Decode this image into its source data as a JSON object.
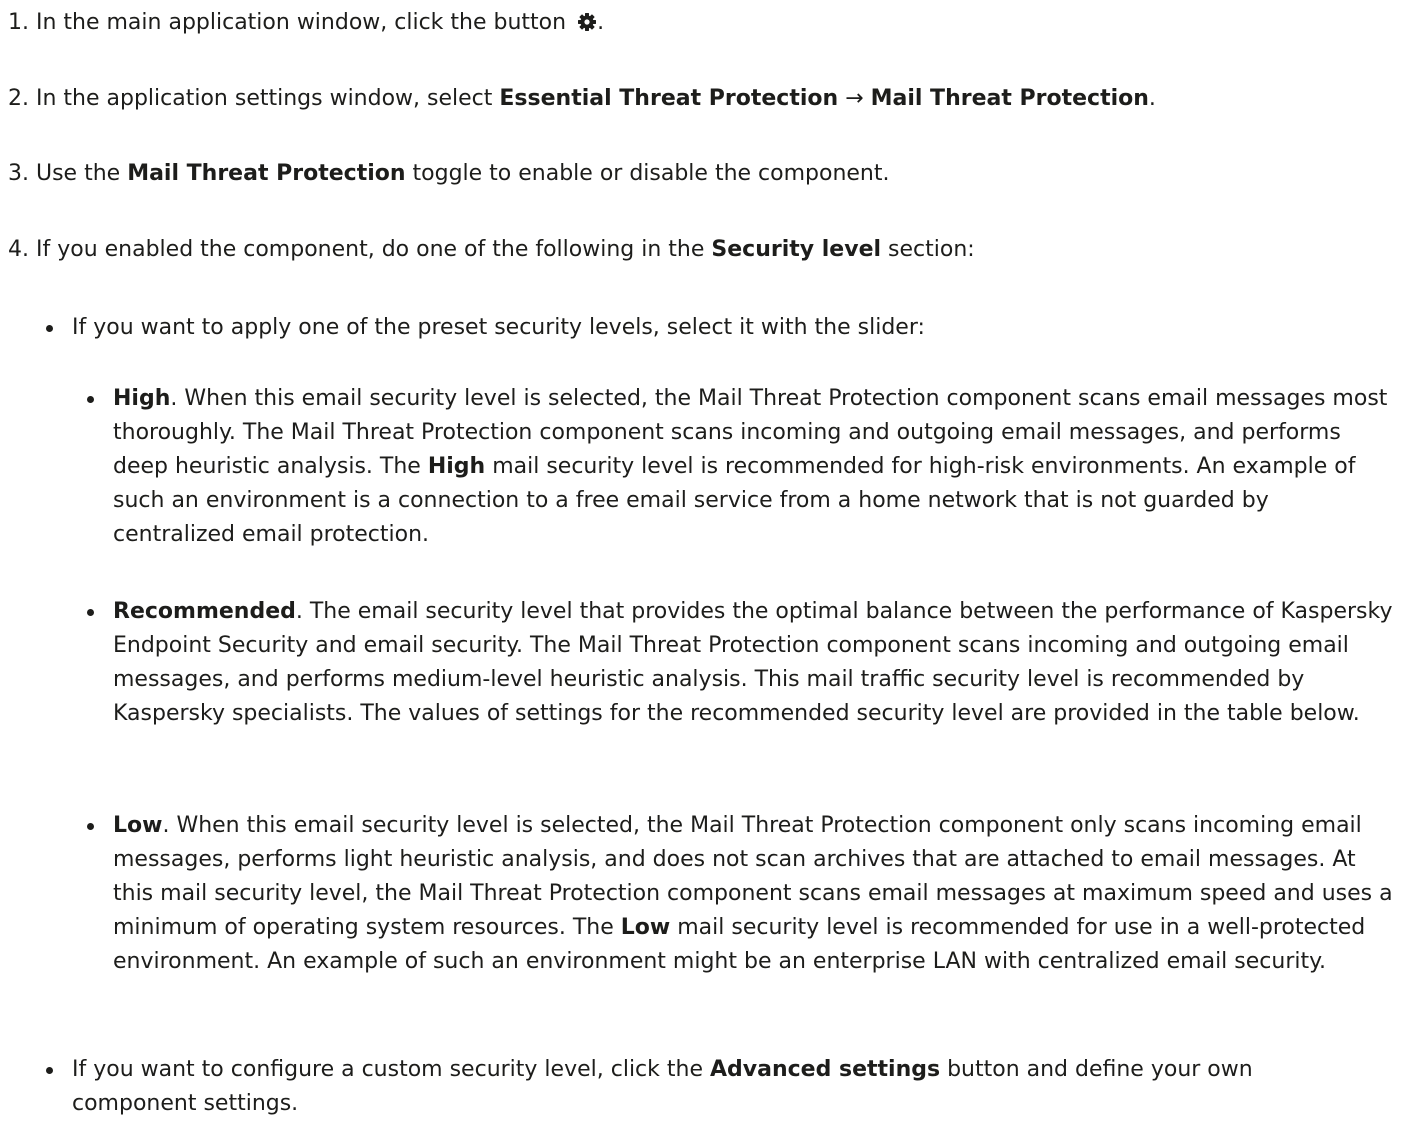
{
  "steps": {
    "s1": {
      "before": "1. In the main application window, click the button ",
      "after": "."
    },
    "s2": {
      "before": "2. In the application settings window, select ",
      "bold1": "Essential Threat Protection",
      "arrow": " → ",
      "bold2": "Mail Threat Protection",
      "after": "."
    },
    "s3": {
      "before": "3. Use the ",
      "bold": "Mail Threat Protection",
      "after": " toggle to enable or disable the component."
    },
    "s4": {
      "before": "4. If you enabled the component, do one of the following in the ",
      "bold": "Security level",
      "after": " section:"
    }
  },
  "bullets": {
    "preset": "If you want to apply one of the preset security levels, select it with the slider:",
    "high": {
      "label": "High",
      "text1": ". When this email security level is selected, the Mail Threat Protection component scans email messages most thoroughly. The Mail Threat Protection component scans incoming and outgoing email messages, and performs deep heuristic analysis. The ",
      "label2": "High",
      "text2": " mail security level is recommended for high-risk environments. An example of such an environment is a connection to a free email service from a home network that is not guarded by centralized email protection."
    },
    "recommended": {
      "label": "Recommended",
      "text": ". The email security level that provides the optimal balance between the performance of Kaspersky Endpoint Security and email security. The Mail Threat Protection component scans incoming and outgoing email messages, and performs medium-level heuristic analysis. This mail traffic security level is recommended by Kaspersky specialists. The values of settings for the recommended security level are provided in the table below."
    },
    "low": {
      "label": "Low",
      "text1": ". When this email security level is selected, the Mail Threat Protection component only scans incoming email messages, performs light heuristic analysis, and does not scan archives that are attached to email messages. At this mail security level, the Mail Threat Protection component scans email messages at maximum speed and uses a minimum of operating system resources. The ",
      "label2": "Low",
      "text2": " mail security level is recommended for use in a well-protected environment. An example of such an environment might be an enterprise LAN with centralized email security."
    },
    "custom": {
      "before": "If you want to configure a custom security level, click the ",
      "bold": "Advanced settings",
      "after": " button and define your own component settings."
    }
  },
  "icons": {
    "settings": "gear-icon"
  },
  "colors": {
    "text": "#1d1d1b",
    "background": "#ffffff"
  }
}
